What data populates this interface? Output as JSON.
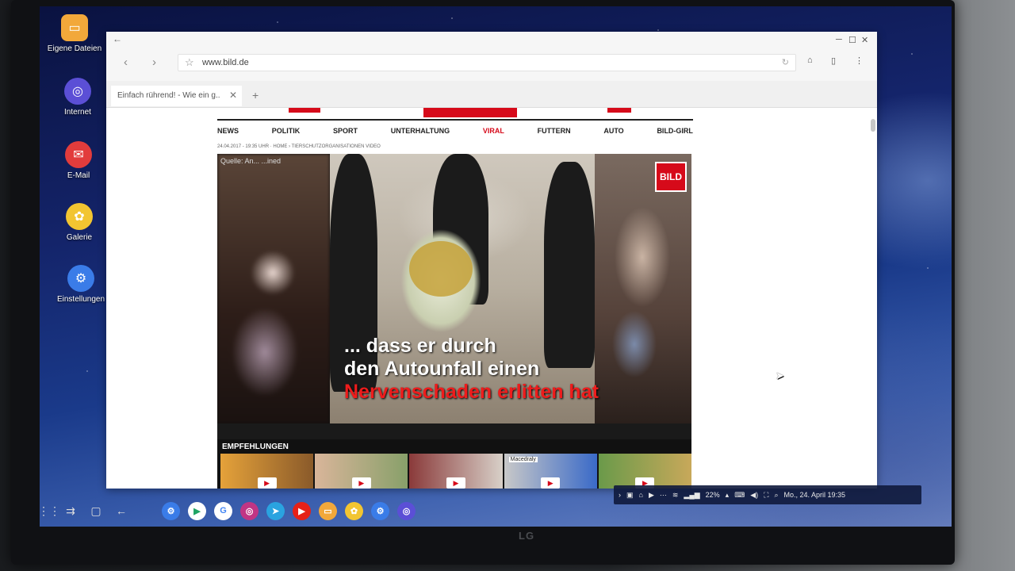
{
  "desktop": {
    "icons": [
      {
        "label": "Eigene Dateien",
        "icon": "folder-icon",
        "color": "#f2a83a"
      },
      {
        "label": "Internet",
        "icon": "internet-planet-icon",
        "color": "#5b4fd6"
      },
      {
        "label": "E-Mail",
        "icon": "mail-icon",
        "color": "#e23c3c"
      },
      {
        "label": "Galerie",
        "icon": "gallery-flower-icon",
        "color": "#f2c531"
      },
      {
        "label": "Einstellungen",
        "icon": "gear-icon",
        "color": "#3a7ce8"
      }
    ]
  },
  "browser": {
    "url": "www.bild.de",
    "tab_title": "Einfach rührend! - Wie ein g...",
    "tab_close": "✕",
    "tab_add": "+"
  },
  "page": {
    "nav": [
      "NEWS",
      "POLITIK",
      "SPORT",
      "UNTERHALTUNG",
      "VIRAL",
      "FUTTERN",
      "AUTO",
      "BILD-GIRL"
    ],
    "breadcrumb": "24.04.2017 - 19:35 UHR · HOME › TIERSCHUTZORGANISATIONEN VIDEO",
    "video": {
      "source": "Quelle: An... ...ined",
      "logo": "BILD",
      "caption_line1": "... dass er durch",
      "caption_line2": "den Autounfall einen",
      "caption_line3": "Nervenschaden erlitten hat"
    },
    "recommendations_title": "EMPFEHLUNGEN",
    "thumb_label": "Macedraly"
  },
  "taskbar": {
    "battery": "22%",
    "datetime": "Mo., 24. April 19:35"
  },
  "monitor_brand": "LG"
}
